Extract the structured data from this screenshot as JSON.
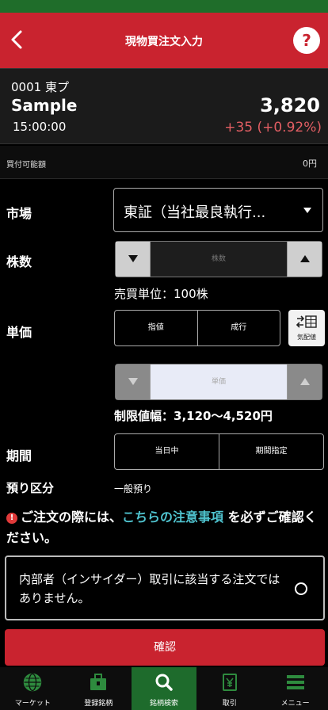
{
  "header": {
    "title": "現物買注文入力",
    "help_label": "?"
  },
  "stock": {
    "code": "0001 東プ",
    "name": "Sample",
    "time": "15:00:00",
    "price": "3,820",
    "change": "+35 (+0.92%)",
    "change_color": "#e15e63"
  },
  "buying_power": {
    "label": "買付可能額",
    "value": "0円"
  },
  "form": {
    "market": {
      "label": "市場",
      "value": "東証（当社最良執行..."
    },
    "quantity": {
      "label": "株数",
      "placeholder": "株数",
      "unit_note": "売買単位：100株"
    },
    "price": {
      "label": "単価",
      "options": [
        "指値",
        "成行"
      ],
      "kehaine_label": "気配値",
      "placeholder": "単価",
      "limit_range": "制限値幅：3,120〜4,520円"
    },
    "period": {
      "label": "期間",
      "options": [
        "当日中",
        "期間指定"
      ]
    },
    "custody": {
      "label": "預り区分",
      "value": "一般預り"
    }
  },
  "notice": {
    "prefix": "ご注文の際には、",
    "link": "こちらの注意事項",
    "suffix": "を必ずご確認ください。"
  },
  "insider": {
    "text": "内部者（インサイダー）取引に該当する注文ではありません。"
  },
  "confirm_label": "確認",
  "tabs": [
    {
      "label": "マーケット",
      "icon": "globe-icon"
    },
    {
      "label": "登録銘柄",
      "icon": "briefcase-icon"
    },
    {
      "label": "銘柄検索",
      "icon": "search-icon",
      "active": true
    },
    {
      "label": "取引",
      "icon": "yen-doc-icon"
    },
    {
      "label": "メニュー",
      "icon": "menu-icon"
    }
  ],
  "colors": {
    "brand_red": "#c9232f",
    "active_tab": "#1e6b2c",
    "link": "#4fc3cf"
  }
}
